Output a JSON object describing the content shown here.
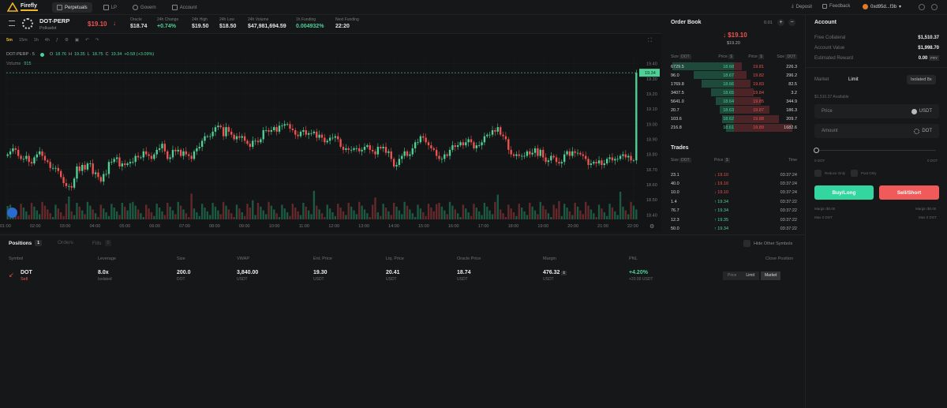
{
  "nav": {
    "logo_text": "Firefly",
    "tabs": [
      {
        "label": "Perpetuals",
        "icon": "chart-icon"
      },
      {
        "label": "LP",
        "icon": "pool-icon"
      },
      {
        "label": "Govern",
        "icon": "govern-icon"
      },
      {
        "label": "Account",
        "icon": "wallet-icon"
      }
    ],
    "deposit": "Deposit",
    "feedback": "Feedback",
    "wallet": "0xd95d...f3b"
  },
  "market": {
    "symbol": "DOT-PERP",
    "name": "Polkadot",
    "price": "$19.10",
    "stats": [
      {
        "k": "Oracle",
        "v": "$18.74",
        "color": ""
      },
      {
        "k": "24h Change",
        "v": "+0.74%",
        "color": "green"
      },
      {
        "k": "24h High",
        "v": "$19.50",
        "color": ""
      },
      {
        "k": "24h Low",
        "v": "$18.50",
        "color": ""
      },
      {
        "k": "24h Volume",
        "v": "$47,981,694.59",
        "color": ""
      },
      {
        "k": "1h Funding",
        "v": "0.004932%",
        "color": "green"
      },
      {
        "k": "Next Funding",
        "v": "22:20",
        "color": ""
      }
    ]
  },
  "chart": {
    "intervals": [
      "5m",
      "15m",
      "1h",
      "4h"
    ],
    "legend_symbol": "DOT-PERP · 5",
    "o": "18.76",
    "h": "19.35",
    "l": "18.75",
    "c": "19.34",
    "chg": "+0.58 (+3.09%)",
    "volume_label": "Volume",
    "volume_value": "915",
    "last_price": "19.34"
  },
  "chart_data": {
    "type": "candlestick",
    "x_ticks": [
      "01:00",
      "02:00",
      "03:00",
      "04:00",
      "05:00",
      "06:00",
      "07:00",
      "08:00",
      "09:00",
      "10:00",
      "11:00",
      "12:00",
      "13:00",
      "14:00",
      "15:00",
      "16:00",
      "17:00",
      "18:00",
      "19:00",
      "20:00",
      "21:00",
      "22:00"
    ],
    "y_ticks": [
      "19.40",
      "19.30",
      "19.20",
      "19.10",
      "19.00",
      "18.90",
      "18.80",
      "18.70",
      "18.60",
      "18.50",
      "18.40"
    ],
    "ylim": [
      18.37,
      19.44
    ],
    "closes": [
      18.8,
      18.82,
      18.84,
      18.83,
      18.79,
      18.77,
      18.77,
      18.79,
      18.75,
      18.74,
      18.78,
      18.8,
      18.82,
      18.79,
      18.76,
      18.75,
      18.71,
      18.71,
      18.71,
      18.69,
      18.65,
      18.61,
      18.59,
      18.59,
      18.58,
      18.64,
      18.72,
      18.69,
      18.73,
      18.7,
      18.74,
      18.74,
      18.67,
      18.68,
      18.65,
      18.62,
      18.67,
      18.67,
      18.75,
      18.75,
      18.77,
      18.78,
      18.72,
      18.74,
      18.73,
      18.74,
      18.75,
      18.75,
      18.79,
      18.78,
      18.78,
      18.82,
      18.8,
      18.79,
      18.77,
      18.8,
      18.83,
      18.84,
      18.87,
      18.82,
      18.77,
      18.78,
      18.83,
      18.82,
      18.83,
      18.79,
      18.82,
      18.8,
      18.79,
      18.77,
      18.82,
      18.84,
      18.85,
      18.89,
      18.92,
      18.92,
      18.92,
      18.95,
      18.98,
      18.99,
      18.98,
      18.92,
      18.98,
      18.95,
      18.93,
      18.9,
      18.92,
      18.91,
      18.92,
      18.89,
      18.87,
      18.85,
      18.89,
      18.89,
      18.88,
      18.9,
      18.96,
      18.96,
      18.95,
      18.96,
      18.98,
      18.95,
      18.99,
      18.99,
      19.0,
      19.0,
      18.97,
      18.96,
      18.93,
      18.92,
      18.95,
      18.96,
      18.93,
      18.94,
      18.94,
      18.95,
      18.91,
      18.93,
      18.91,
      18.88,
      18.89,
      18.91,
      18.91,
      18.92,
      18.9,
      18.85,
      18.83,
      18.84,
      18.83,
      18.83,
      18.84,
      18.84,
      18.82,
      18.83,
      18.85,
      18.86,
      18.83,
      18.82,
      18.8,
      18.85,
      18.84,
      18.85,
      18.81,
      18.82,
      18.77,
      18.72,
      18.73,
      18.77,
      18.79,
      18.82,
      18.79,
      18.8,
      18.84,
      18.88,
      18.88,
      18.92,
      18.91,
      18.88,
      18.86,
      18.84,
      18.83,
      18.79,
      18.77,
      18.77,
      18.8,
      18.79,
      18.83,
      18.86,
      18.85,
      18.86,
      18.88,
      18.86,
      18.88,
      18.9,
      18.88,
      18.84,
      18.86,
      18.86,
      18.88,
      18.92,
      18.93,
      18.93,
      18.96,
      18.95,
      18.98,
      18.93,
      18.92,
      18.9,
      18.83,
      18.8,
      18.79,
      18.8,
      18.79,
      18.79,
      18.79,
      18.82,
      18.8,
      18.81,
      18.84,
      18.79,
      18.83,
      18.78,
      18.75,
      18.76,
      18.79,
      18.78,
      18.75,
      18.74,
      18.75,
      18.8,
      18.82,
      18.79,
      18.82,
      18.81,
      18.81,
      18.8,
      18.79,
      18.77,
      18.73,
      18.74,
      18.75,
      18.74,
      18.76,
      18.73,
      18.74,
      18.77,
      18.78,
      18.76,
      18.77,
      18.77,
      18.79,
      18.8,
      18.78,
      18.79,
      18.76,
      18.76,
      19.34
    ]
  },
  "orderbook": {
    "title": "Order Book",
    "step": "0.01",
    "mark_price": "$19.10",
    "index_price": "$19.20",
    "cols": [
      "Size",
      "DOT",
      "Price",
      "$",
      "Price",
      "$",
      "Size",
      "DOT"
    ],
    "rows": [
      {
        "bs": "6729.5",
        "bp": "18.68",
        "ap": "19.81",
        "as": "226.3",
        "bd": 0.95,
        "ad": 0.12
      },
      {
        "bs": "96.0",
        "bp": "18.67",
        "ap": "19.82",
        "as": "296.2",
        "bd": 0.62,
        "ad": 0.2
      },
      {
        "bs": "1769.8",
        "bp": "18.66",
        "ap": "19.83",
        "as": "82.5",
        "bd": 0.5,
        "ad": 0.26
      },
      {
        "bs": "3407.5",
        "bp": "18.65",
        "ap": "19.84",
        "as": "3.2",
        "bd": 0.35,
        "ad": 0.3
      },
      {
        "bs": "5641.0",
        "bp": "18.64",
        "ap": "19.85",
        "as": "344.9",
        "bd": 0.28,
        "ad": 0.42
      },
      {
        "bs": "20.7",
        "bp": "18.63",
        "ap": "19.87",
        "as": "186.3",
        "bd": 0.22,
        "ad": 0.55
      },
      {
        "bs": "103.6",
        "bp": "18.62",
        "ap": "19.88",
        "as": "209.7",
        "bd": 0.18,
        "ad": 0.7
      },
      {
        "bs": "216.8",
        "bp": "18.61",
        "ap": "19.89",
        "as": "1682.6",
        "bd": 0.12,
        "ad": 0.9
      }
    ]
  },
  "trades": {
    "title": "Trades",
    "cols": [
      "Size",
      "DOT",
      "Price",
      "$",
      "Time"
    ],
    "rows": [
      {
        "size": "23.1",
        "price": "19.10",
        "dir": "down",
        "time": "03:37:24"
      },
      {
        "size": "40.0",
        "price": "19.10",
        "dir": "down",
        "time": "03:37:24"
      },
      {
        "size": "10.0",
        "price": "19.10",
        "dir": "down",
        "time": "03:37:24"
      },
      {
        "size": "1.4",
        "price": "19.34",
        "dir": "up",
        "time": "03:37:22"
      },
      {
        "size": "76.7",
        "price": "19.34",
        "dir": "up",
        "time": "03:37:22"
      },
      {
        "size": "12.3",
        "price": "19.35",
        "dir": "up",
        "time": "03:37:22"
      },
      {
        "size": "50.0",
        "price": "19.34",
        "dir": "up",
        "time": "03:37:22"
      }
    ]
  },
  "account": {
    "title": "Account",
    "rows": [
      {
        "k": "Free Collateral",
        "v": "$1,510.37"
      },
      {
        "k": "Account Value",
        "v": "$1,998.70"
      },
      {
        "k": "Estimated Reward",
        "v": "0.00"
      }
    ],
    "reward_unit": "FRY",
    "order_tabs": [
      "Market",
      "Limit"
    ],
    "leverage_btn": "Isolated 8x",
    "available": "$1,510.37 Available",
    "price_placeholder": "Price",
    "price_unit": "USDT",
    "amount_placeholder": "Amount",
    "amount_unit": "DOT",
    "slider_min": "0 DOT",
    "slider_max": "0 DOT",
    "reduce_only": "Reduce Only",
    "post_only": "Post Only",
    "buy": "Buy/Long",
    "sell": "Sell/Short",
    "margin_l": "Margin $0.00",
    "margin_r": "Margin $0.00",
    "max_l": "Max 0 DOT",
    "max_r": "Max 0 DOT"
  },
  "positions": {
    "tabs": [
      {
        "label": "Positions",
        "count": "1"
      },
      {
        "label": "Orders",
        "count": ""
      },
      {
        "label": "Fills",
        "count": "0"
      }
    ],
    "hide_other": "Hide Other Symbols",
    "headers": [
      "Symbol",
      "Leverage",
      "Size",
      "VWAP",
      "Ent. Price",
      "Liq. Price",
      "Oracle Price",
      "Margin",
      "PNL",
      "Close Position"
    ],
    "row": {
      "symbol": "DOT",
      "side": "Sell",
      "leverage": "8.0x",
      "leverage_sub": "Isolated",
      "size": "200.0",
      "size_unit": "DOT",
      "vwap": "3,840.00",
      "vwap_unit": "USDT",
      "entry": "19.30",
      "entry_unit": "USDT",
      "liq": "20.41",
      "liq_unit": "USDT",
      "oracle": "18.74",
      "oracle_unit": "USDT",
      "margin": "476.32",
      "margin_unit": "USDT",
      "pnl": "+4.20%",
      "pnl_sub": "+20.00",
      "pnl_unit": "USDT",
      "close_btns": [
        "Price",
        "Limit",
        "Market"
      ]
    }
  },
  "colors": {
    "up": "#4fd196",
    "down": "#ef5350",
    "bg": "#161718"
  }
}
